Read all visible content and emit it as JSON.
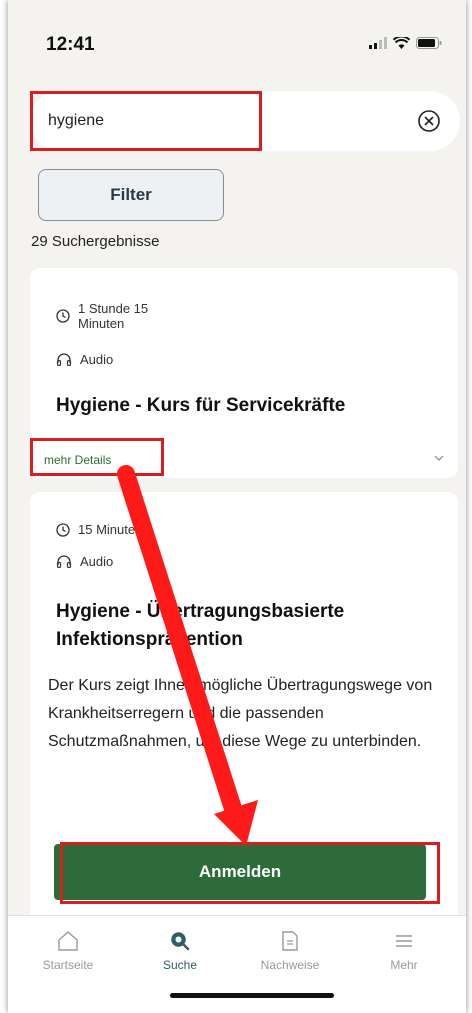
{
  "status_bar": {
    "time": "12:41"
  },
  "search": {
    "value": "hygiene"
  },
  "filter": {
    "label": "Filter"
  },
  "results": {
    "count_text": "29 Suchergebnisse"
  },
  "cards": [
    {
      "duration": "1 Stunde 15\nMinuten",
      "media": "Audio",
      "title": "Hygiene - Kurs für Servicekräfte",
      "details_link": "mehr Details"
    },
    {
      "duration": "15 Minuten",
      "media": "Audio",
      "title": "Hygiene - Übertragungsbasierte Infektionsprävention",
      "description": "Der Kurs zeigt Ihnen mögliche Übertragungswege von Krankheitserregern und die passenden Schutzmaßnahmen, um diese Wege zu unterbinden.",
      "button_label": "Anmelden"
    }
  ],
  "tab_bar": {
    "tabs": [
      {
        "label": "Startseite",
        "icon": "home-icon"
      },
      {
        "label": "Suche",
        "icon": "search-icon",
        "active": true
      },
      {
        "label": "Nachweise",
        "icon": "document-icon"
      },
      {
        "label": "Mehr",
        "icon": "menu-icon"
      }
    ]
  },
  "colors": {
    "primary": "#2e6b3a",
    "highlight": "#d61f1f",
    "arrow": "#ff1a1a"
  }
}
